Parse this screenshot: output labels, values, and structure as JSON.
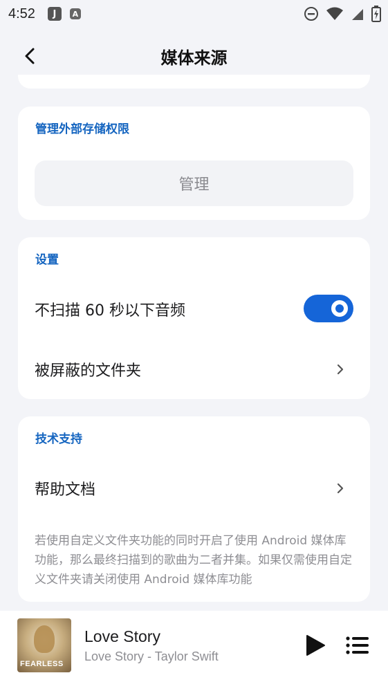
{
  "status_bar": {
    "time": "4:52",
    "app_icon_1": "J",
    "app_icon_2": "A",
    "icons": [
      "do-not-disturb-icon",
      "wifi-icon",
      "signal-icon",
      "battery-icon"
    ]
  },
  "header": {
    "title": "媒体来源",
    "back_icon": "back-arrow-icon"
  },
  "storage_section": {
    "title": "管理外部存储权限",
    "manage_label": "管理"
  },
  "settings_section": {
    "title": "设置",
    "skip_short_label": "不扫描 60 秒以下音频",
    "skip_short_enabled": true,
    "blocked_folders_label": "被屏蔽的文件夹"
  },
  "support_section": {
    "title": "技术支持",
    "help_label": "帮助文档",
    "note": "若使用自定义文件夹功能的同时开启了使用 Android 媒体库功能，那么最终扫描到的歌曲为二者并集。如果仅需使用自定义文件夹请关闭使用 Android 媒体库功能"
  },
  "player": {
    "album_art_text": "FEARLESS",
    "song_title": "Love Story",
    "song_subtitle": "Love Story - Taylor Swift"
  },
  "colors": {
    "accent": "#1565d8",
    "section_title": "#1565c0",
    "background": "#f3f4f8"
  }
}
